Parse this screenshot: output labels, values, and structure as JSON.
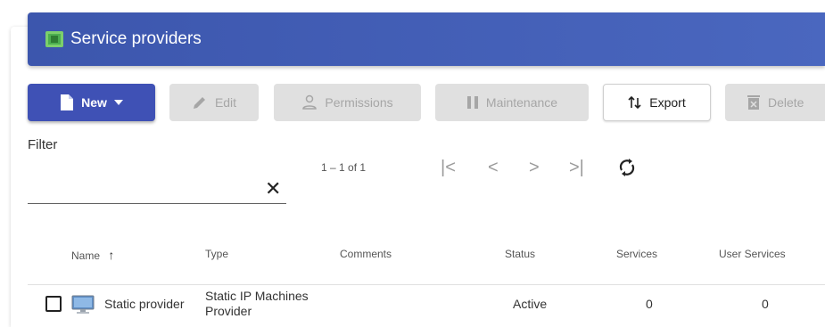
{
  "header": {
    "title": "Service providers"
  },
  "toolbar": {
    "new_label": "New",
    "edit_label": "Edit",
    "permissions_label": "Permissions",
    "maintenance_label": "Maintenance",
    "export_label": "Export",
    "delete_label": "Delete"
  },
  "filter": {
    "label": "Filter",
    "value": ""
  },
  "pagination": {
    "range_label": "1 – 1 of 1"
  },
  "table": {
    "columns": [
      "Name",
      "Type",
      "Comments",
      "Status",
      "Services",
      "User Services"
    ],
    "rows": [
      {
        "name": "Static provider",
        "type_line1": "Static IP Machines",
        "type_line2": "Provider",
        "comments": "",
        "status": "Active",
        "services": "0",
        "user_services": "0"
      }
    ]
  },
  "colors": {
    "header": "#3f5bb0",
    "primary_button": "#3f51b5"
  },
  "icons": [
    "provider-icon",
    "new-document-icon",
    "dropdown-arrow-icon",
    "pencil-icon",
    "person-icon",
    "pause-icon",
    "export-icon",
    "trash-icon",
    "close-icon",
    "first-page-icon",
    "prev-page-icon",
    "next-page-icon",
    "last-page-icon",
    "refresh-icon",
    "sort-arrow-up-icon",
    "monitor-icon"
  ]
}
